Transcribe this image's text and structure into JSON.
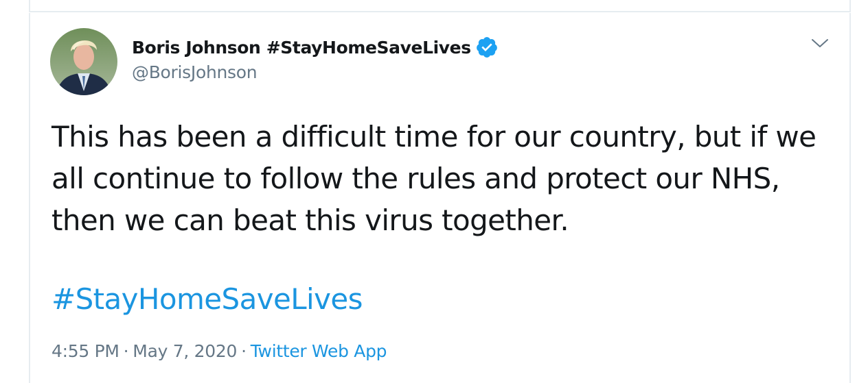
{
  "author": {
    "display_name": "Boris Johnson #StayHomeSaveLives",
    "handle": "@BorisJohnson",
    "verified": true,
    "avatar_icon": "profile-photo"
  },
  "tweet": {
    "text": "This has been a difficult time for our country, but if we all continue to follow the rules and protect our NHS, then we can beat this virus together.",
    "hashtag": "#StayHomeSaveLives"
  },
  "meta": {
    "time": "4:55 PM",
    "separator": "·",
    "date": "May 7, 2020",
    "source": "Twitter Web App"
  },
  "colors": {
    "text": "#14171a",
    "secondary": "#657786",
    "link": "#1b95e0",
    "verified": "#1da1f2",
    "border": "#e6ecf0"
  },
  "icons": {
    "menu": "chevron-down-icon",
    "verified": "verified-badge-icon"
  }
}
